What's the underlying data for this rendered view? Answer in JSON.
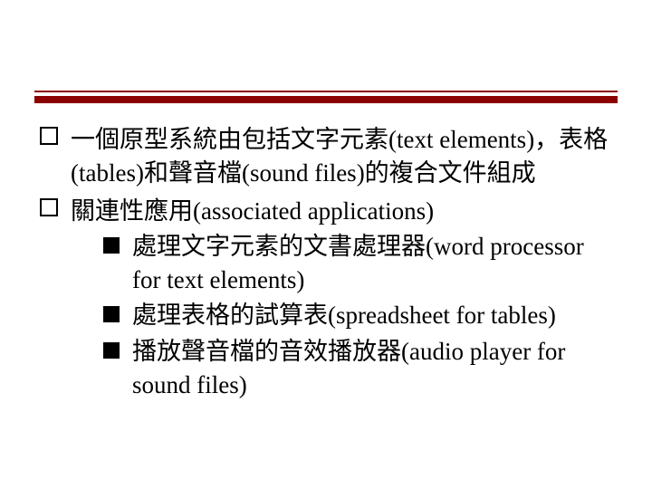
{
  "accent_color": "#8b0000",
  "bullets_level1": [
    {
      "text": "一個原型系統由包括文字元素(text elements)，表格(tables)和聲音檔(sound files)的複合文件組成",
      "sublist": []
    },
    {
      "text": "關連性應用(associated applications)",
      "sublist": [
        "處理文字元素的文書處理器(word processor for text elements)",
        "處理表格的試算表(spreadsheet for tables)",
        "播放聲音檔的音效播放器(audio player for sound files)"
      ]
    }
  ]
}
